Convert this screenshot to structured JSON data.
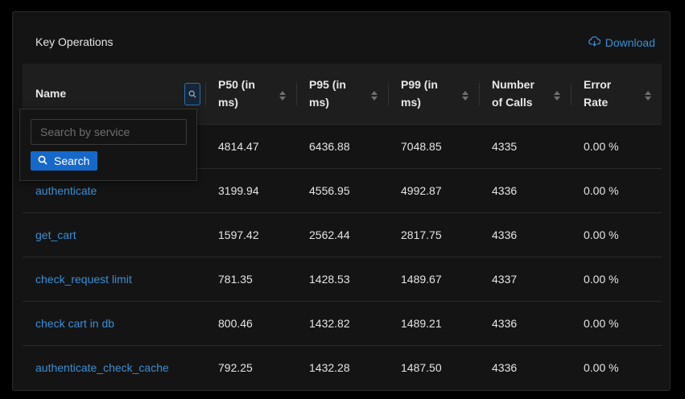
{
  "panel": {
    "title": "Key Operations",
    "download_label": "Download"
  },
  "table": {
    "columns": [
      "Name",
      "P50 (in ms)",
      "P95 (in ms)",
      "P99 (in ms)",
      "Number of Calls",
      "Error Rate"
    ],
    "rows": [
      {
        "name": "",
        "p50": "4814.47",
        "p95": "6436.88",
        "p99": "7048.85",
        "calls": "4335",
        "error": "0.00 %"
      },
      {
        "name": "authenticate",
        "p50": "3199.94",
        "p95": "4556.95",
        "p99": "4992.87",
        "calls": "4336",
        "error": "0.00 %"
      },
      {
        "name": "get_cart",
        "p50": "1597.42",
        "p95": "2562.44",
        "p99": "2817.75",
        "calls": "4336",
        "error": "0.00 %"
      },
      {
        "name": "check_request limit",
        "p50": "781.35",
        "p95": "1428.53",
        "p99": "1489.67",
        "calls": "4337",
        "error": "0.00 %"
      },
      {
        "name": "check cart in db",
        "p50": "800.46",
        "p95": "1432.82",
        "p99": "1489.21",
        "calls": "4336",
        "error": "0.00 %"
      },
      {
        "name": "authenticate_check_cache",
        "p50": "792.25",
        "p95": "1432.28",
        "p99": "1487.50",
        "calls": "4336",
        "error": "0.00 %"
      }
    ]
  },
  "filter": {
    "placeholder": "Search by service",
    "button_label": "Search"
  },
  "icons": {
    "download": "cloud-download-icon",
    "filter": "search-icon",
    "sort": "sort-icon"
  },
  "colors": {
    "accent": "#3a8fd6",
    "button": "#1668c9",
    "panel_bg": "#141414",
    "header_bg": "#1e1e1e"
  }
}
